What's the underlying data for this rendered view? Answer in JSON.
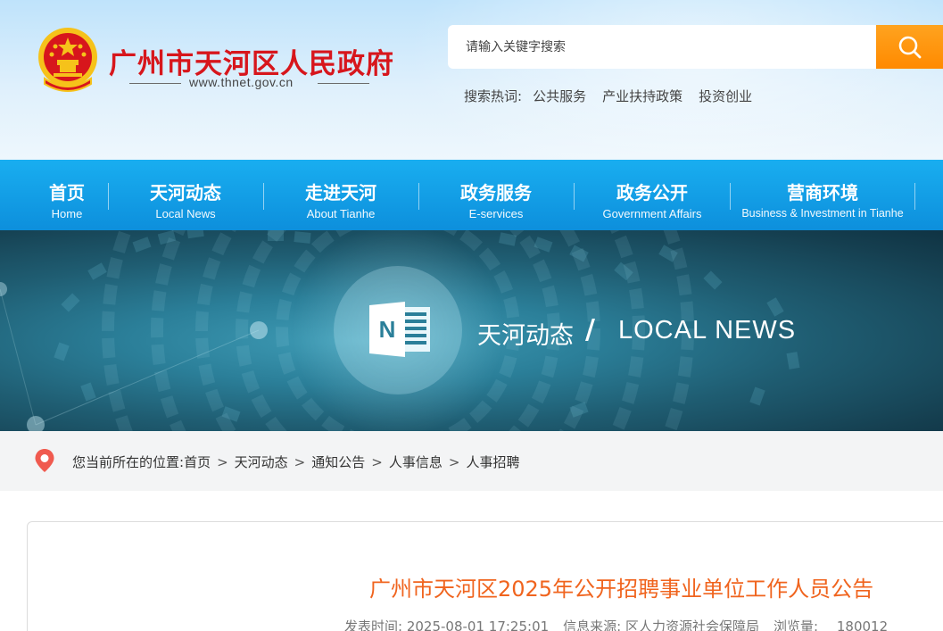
{
  "site": {
    "title": "广州市天河区人民政府",
    "url": "www.thnet.gov.cn"
  },
  "search": {
    "placeholder": "请输入关键字搜索",
    "hot_label": "搜索热词:",
    "hot_words": [
      "公共服务",
      "产业扶持政策",
      "投资创业"
    ]
  },
  "nav": {
    "items": [
      {
        "cn": "首页",
        "en": "Home"
      },
      {
        "cn": "天河动态",
        "en": "Local News"
      },
      {
        "cn": "走进天河",
        "en": "About Tianhe"
      },
      {
        "cn": "政务服务",
        "en": "E-services"
      },
      {
        "cn": "政务公开",
        "en": "Government Affairs"
      },
      {
        "cn": "营商环境",
        "en": "Business & Investment in Tianhe"
      }
    ]
  },
  "banner": {
    "cn": "天河动态",
    "slash": "/",
    "en": "LOCAL NEWS",
    "icon_letter": "N"
  },
  "breadcrumb": {
    "label": "您当前所在的位置:",
    "items": [
      "首页",
      "天河动态",
      "通知公告",
      "人事信息",
      "人事招聘"
    ],
    "separator": ">"
  },
  "article": {
    "title": "广州市天河区2025年公开招聘事业单位工作人员公告",
    "publish_label": "发表时间:",
    "publish_time": "2025-08-01 17:25:01",
    "source_label": "信息来源:",
    "source": "区人力资源社会保障局",
    "views_label": "浏览量:",
    "views": "180012"
  },
  "colors": {
    "brand_red": "#d7161c",
    "nav_blue": "#1096e0",
    "search_orange": "#ff9a10",
    "title_orange": "#f0641e"
  }
}
